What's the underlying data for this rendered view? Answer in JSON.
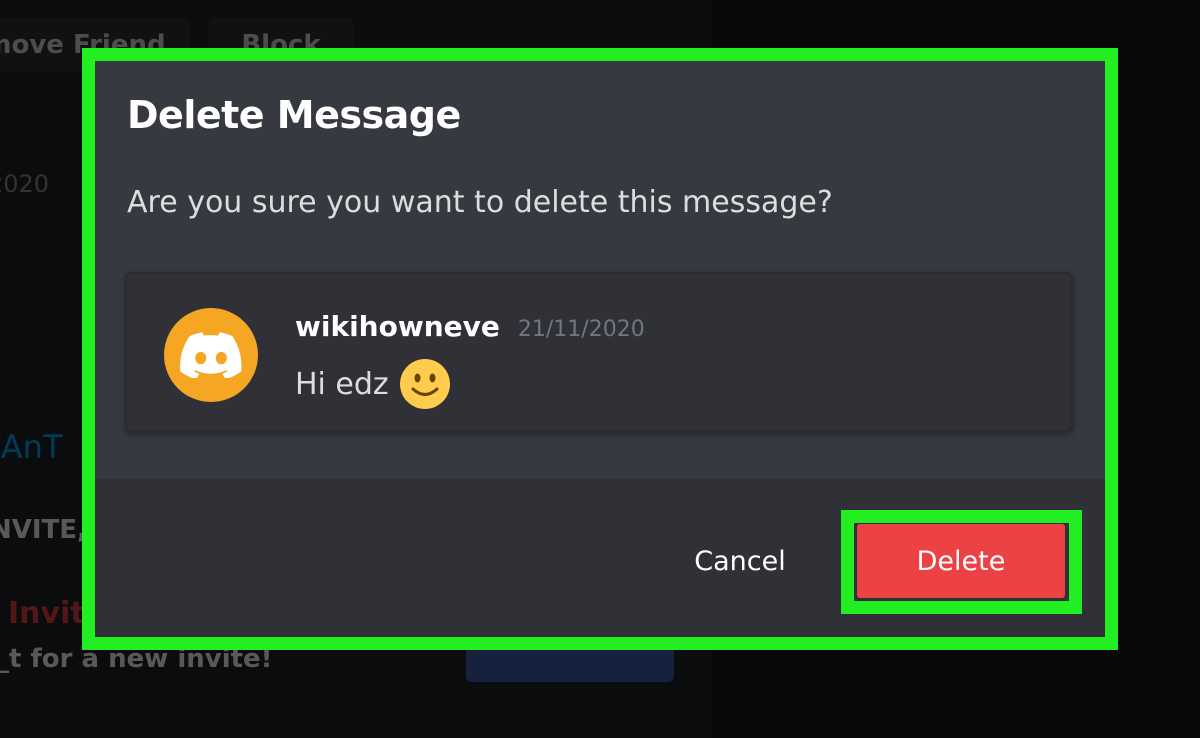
{
  "background": {
    "remove_friend_label": "move Friend",
    "block_label": "Block",
    "date_fragment": "2020",
    "link_fragment": "/AnT",
    "invite_fragment_1": "NVITE,",
    "invite_fragment_2": "Invit",
    "invite_fragment_3": "_t for a new invite!"
  },
  "modal": {
    "title": "Delete Message",
    "question": "Are you sure you want to delete this message?",
    "message": {
      "author": "wikihowneve",
      "timestamp": "21/11/2020",
      "text": "Hi edz",
      "emoji_icon": "slightly-smiling-face-icon",
      "avatar_icon": "discord-logo-icon",
      "avatar_color": "#f5a623"
    },
    "cancel_label": "Cancel",
    "delete_label": "Delete"
  },
  "colors": {
    "highlight": "#22ee22",
    "danger": "#ed4245",
    "modal_bg": "#36393f",
    "footer_bg": "#2f3136"
  }
}
